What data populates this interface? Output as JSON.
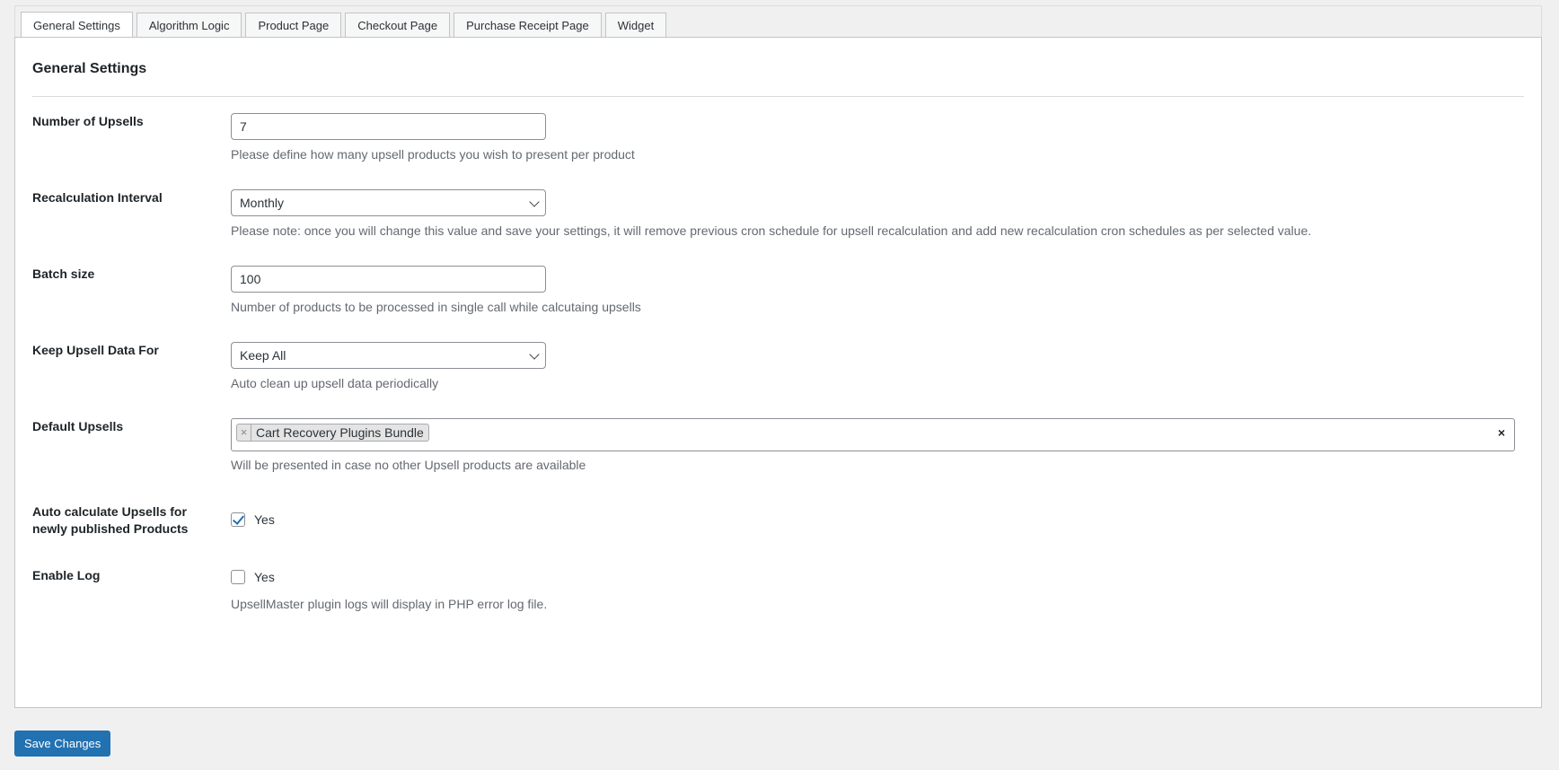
{
  "tabs": [
    {
      "label": "General Settings",
      "active": true
    },
    {
      "label": "Algorithm Logic"
    },
    {
      "label": "Product Page"
    },
    {
      "label": "Checkout Page"
    },
    {
      "label": "Purchase Receipt Page"
    },
    {
      "label": "Widget"
    }
  ],
  "panel": {
    "title": "General Settings"
  },
  "fields": {
    "num_upsells": {
      "label": "Number of Upsells",
      "value": "7",
      "desc": "Please define how many upsell products you wish to present per product"
    },
    "recalc": {
      "label": "Recalculation Interval",
      "value": "Monthly",
      "desc": "Please note: once you will change this value and save your settings, it will remove previous cron schedule for upsell recalculation and add new recalculation cron schedules as per selected value."
    },
    "batch": {
      "label": "Batch size",
      "value": "100",
      "desc": "Number of products to be processed in single call while calcutaing upsells"
    },
    "keep": {
      "label": "Keep Upsell Data For",
      "value": "Keep All",
      "desc": "Auto clean up upsell data periodically"
    },
    "default": {
      "label": "Default Upsells",
      "chip": "Cart Recovery Plugins Bundle",
      "chip_remove": "×",
      "clear": "×",
      "desc": "Will be presented in case no other Upsell products are available"
    },
    "auto": {
      "label_line1": "Auto calculate Upsells for",
      "label_line2": "newly published Products",
      "checked": true,
      "option": "Yes"
    },
    "log": {
      "label": "Enable Log",
      "checked": false,
      "option": "Yes",
      "desc": "UpsellMaster plugin logs will display in PHP error log file."
    }
  },
  "save_label": "Save Changes",
  "colors": {
    "accent": "#2271b1",
    "background": "#f0f0f1",
    "panel": "#ffffff"
  }
}
